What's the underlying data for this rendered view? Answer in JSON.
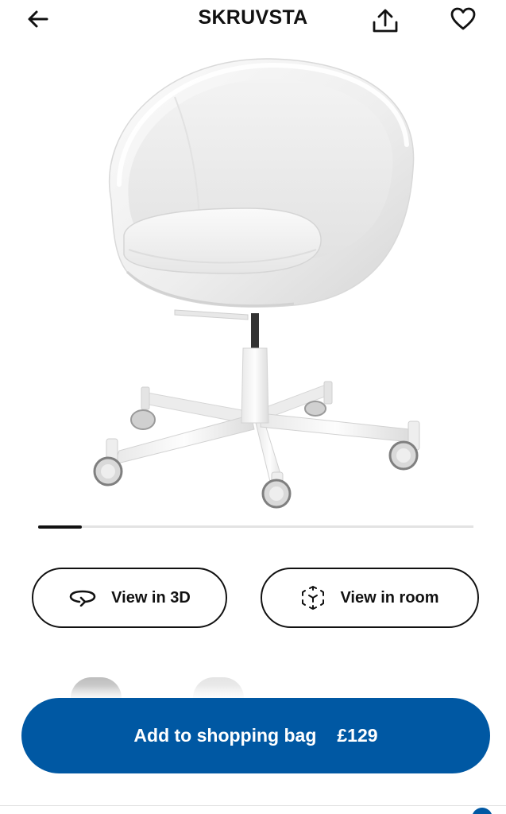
{
  "header": {
    "title": "SKRUVSTA",
    "back_icon": "arrow-left-icon",
    "share_icon": "share-upload-icon",
    "favorite_icon": "heart-outline-icon"
  },
  "gallery": {
    "image_alt": "White swivel chair",
    "current_index": 1,
    "progress_fraction": 0.1
  },
  "actions": {
    "view_3d": {
      "label": "View in 3D",
      "icon": "rotate-3d-icon"
    },
    "view_room": {
      "label": "View in room",
      "icon": "ar-cube-icon"
    }
  },
  "cta": {
    "label": "Add to shopping bag",
    "price": "£129"
  },
  "colors": {
    "brand_blue": "#0058a3",
    "text": "#111111",
    "track": "#e3e3e3"
  }
}
